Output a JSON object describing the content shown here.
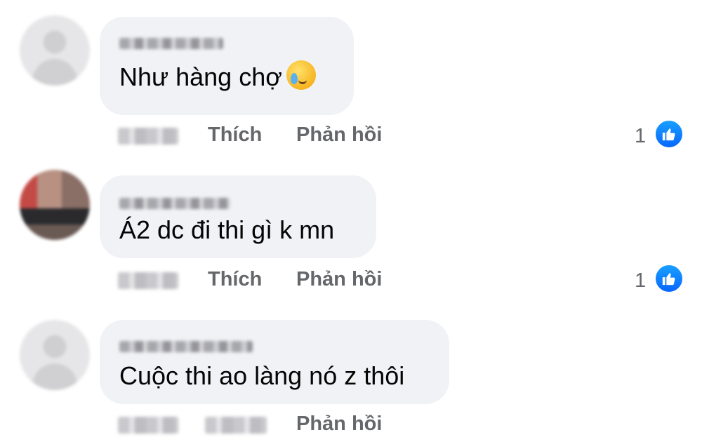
{
  "comments": [
    {
      "text": "Như hàng chợ",
      "emoji": "crying-face-emoji",
      "avatar": "gray-placeholder",
      "like_label": "Thích",
      "reply_label": "Phản hồi",
      "reaction_count": "1"
    },
    {
      "text": "Á2 dc đi thi gì k mn",
      "avatar": "photo",
      "like_label": "Thích",
      "reply_label": "Phản hồi",
      "reaction_count": "1"
    },
    {
      "text": "Cuộc thi ao làng nó z thôi",
      "avatar": "gray-placeholder",
      "reply_label": "Phản hồi"
    }
  ],
  "colors": {
    "bubble": "#f0f2f5",
    "meta": "#65676b",
    "like_blue": "#0866ff"
  }
}
